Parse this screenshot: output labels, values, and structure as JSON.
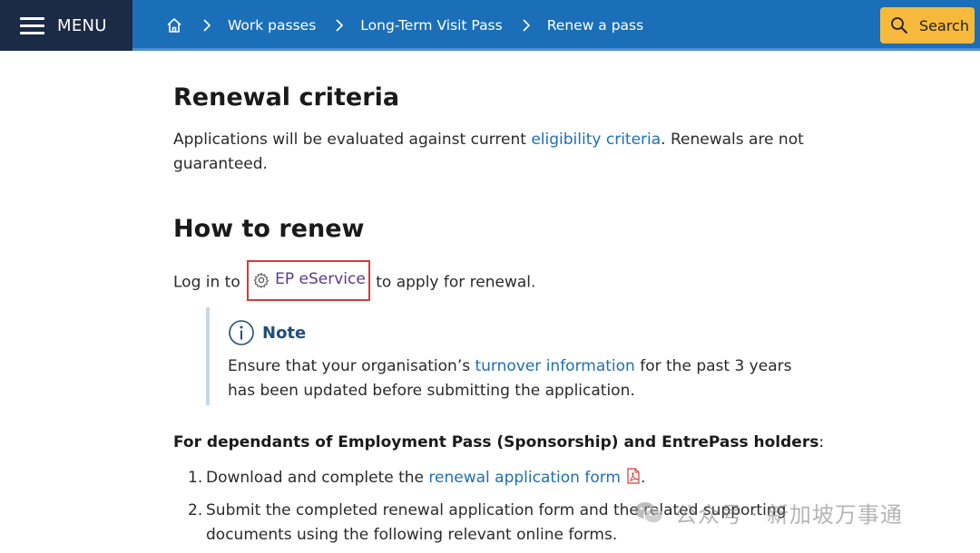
{
  "header": {
    "menu_label": "MENU",
    "breadcrumb": [
      "Work passes",
      "Long-Term Visit Pass",
      "Renew a pass"
    ],
    "search_label": "Search",
    "colors": {
      "bar": "#1b6fb8",
      "menu_bg": "#1b2a45",
      "search_bg": "#f6b93b"
    }
  },
  "main": {
    "renewal": {
      "heading": "Renewal criteria",
      "text_before": "Applications will be evaluated against current ",
      "link": "eligibility criteria",
      "text_after": ". Renewals are not guaranteed."
    },
    "how_to": {
      "heading": "How to renew",
      "text_before": "Log in to ",
      "link": "EP eService",
      "text_after": " to apply for renewal."
    },
    "note": {
      "title": "Note",
      "text_before": "Ensure that your organisation’s ",
      "link": "turnover information",
      "text_after": " for the past 3 years has been updated before submitting the application."
    },
    "dependants": {
      "bold": "For dependants of Employment Pass (Sponsorship) and EntrePass holders",
      "suffix": ":"
    },
    "steps": [
      {
        "num": "1.",
        "text_before": "Download and complete the ",
        "link": "renewal application form",
        "text_after": "."
      },
      {
        "num": "2.",
        "text": "Submit the completed renewal application form and the related supporting documents using the following relevant online forms."
      }
    ]
  },
  "watermark": {
    "text": "公众号 · 新加坡万事通",
    "icon": "wechat-icon"
  }
}
